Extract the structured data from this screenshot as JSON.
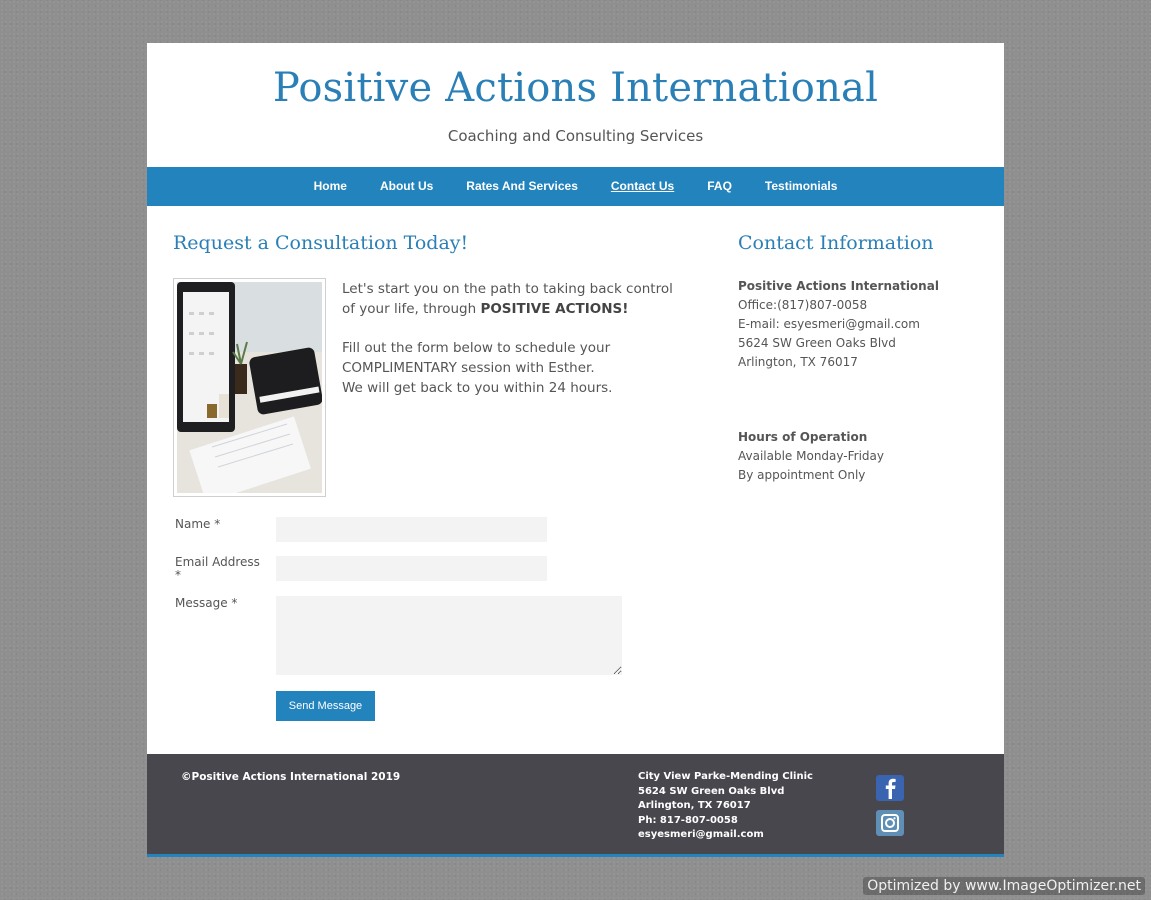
{
  "header": {
    "title": "Positive Actions International",
    "tagline": "Coaching and Consulting Services"
  },
  "nav": {
    "items": [
      {
        "label": "Home"
      },
      {
        "label": "About Us"
      },
      {
        "label": "Rates And Services"
      },
      {
        "label": "Contact Us",
        "active": true
      },
      {
        "label": "FAQ"
      },
      {
        "label": "Testimonials"
      }
    ]
  },
  "main": {
    "heading": "Request a Consultation Today!",
    "intro_line1": "Let's start you on the path to taking back control of your life, through ",
    "intro_emphasis": "POSITIVE ACTIONS!",
    "intro_line2": "Fill out the form below to schedule your COMPLIMENTARY session with Esther.",
    "intro_line3": "We will get back to you within 24 hours."
  },
  "form": {
    "name_label": "Name *",
    "email_label": "Email Address *",
    "message_label": "Message *",
    "submit_label": "Send Message"
  },
  "contact": {
    "heading": "Contact Information",
    "org": "Positive Actions International",
    "office": "Office:(817)807-0058",
    "email": "E-mail: esyesmeri@gmail.com",
    "street": "5624 SW Green Oaks Blvd",
    "city": "Arlington, TX 76017",
    "hours_heading": "Hours of Operation",
    "hours_line1": "Available Monday-Friday",
    "hours_line2": "By appointment Only"
  },
  "footer": {
    "copyright": "©Positive Actions International 2019",
    "clinic": "City View Parke-Mending Clinic",
    "street": "5624 SW Green Oaks Blvd",
    "city": "Arlington, TX 76017",
    "phone": "Ph: 817-807-0058",
    "email": "esyesmeri@gmail.com",
    "social": [
      "facebook-icon",
      "instagram-icon"
    ]
  },
  "watermark": "Optimized by www.ImageOptimizer.net",
  "colors": {
    "accent": "#2383bd",
    "title": "#2a7fb6",
    "footer_bg": "#47474d",
    "page_bg": "#8f8f8f"
  }
}
